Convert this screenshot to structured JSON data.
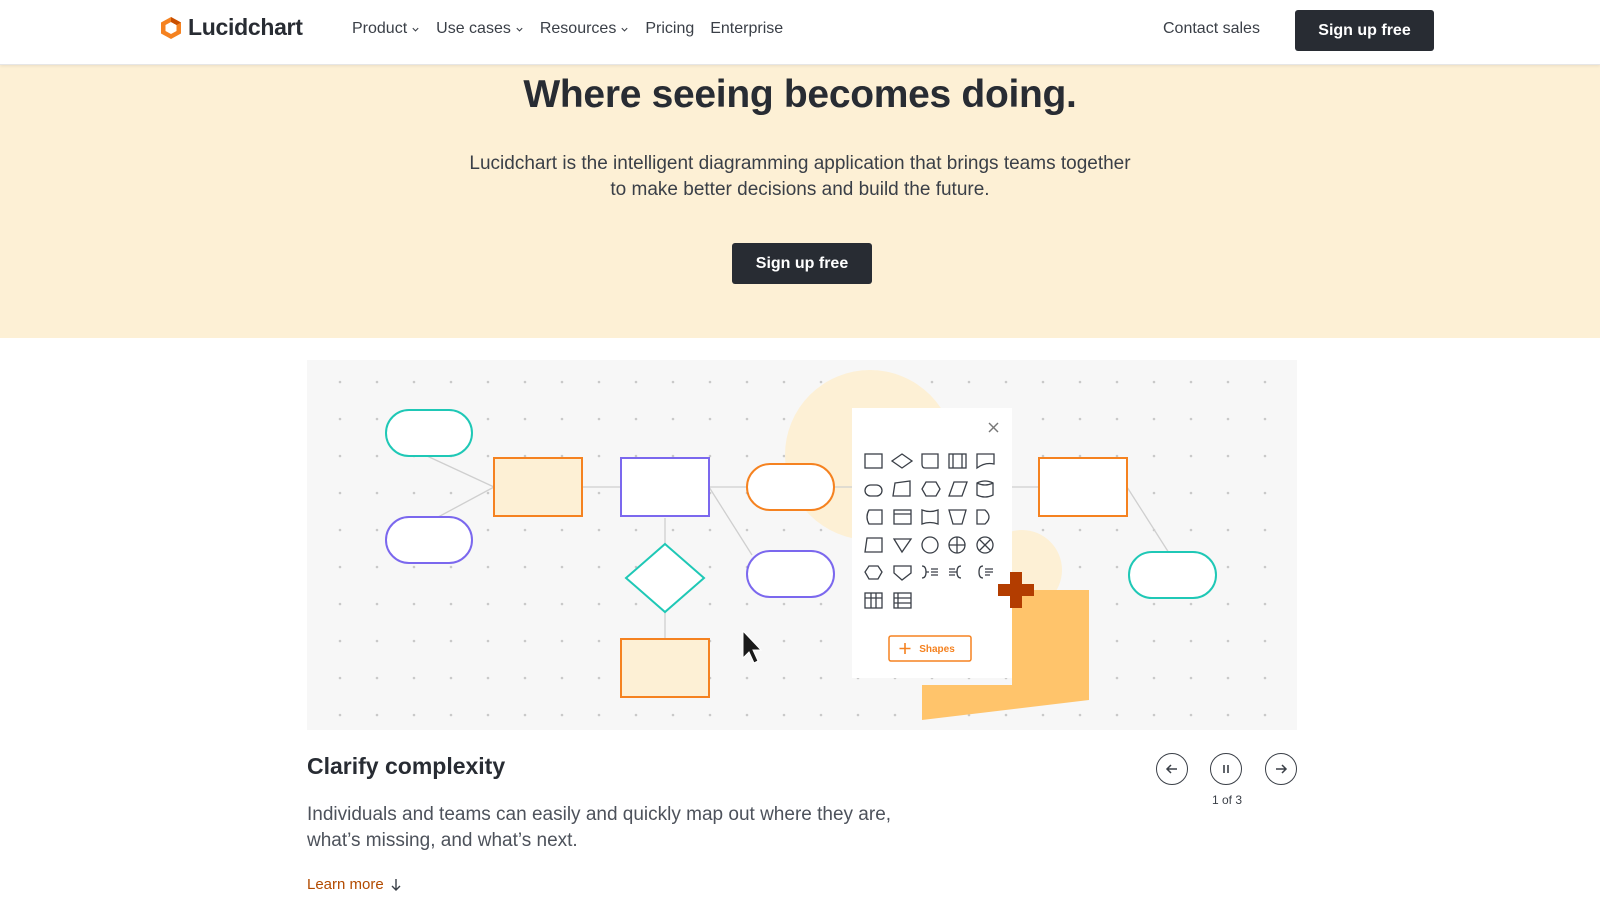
{
  "nav": {
    "logo_text": "Lucidchart",
    "links": [
      {
        "label": "Product",
        "dropdown": true
      },
      {
        "label": "Use cases",
        "dropdown": true
      },
      {
        "label": "Resources",
        "dropdown": true
      },
      {
        "label": "Pricing",
        "dropdown": false
      },
      {
        "label": "Enterprise",
        "dropdown": false
      }
    ],
    "contact_label": "Contact sales",
    "signup_label": "Sign up free"
  },
  "hero": {
    "title": "Where seeing becomes doing.",
    "subtitle_line1": "Lucidchart is the intelligent diagramming application that brings teams together",
    "subtitle_line2": "to make better decisions and build the future.",
    "cta_label": "Sign up free"
  },
  "illustration": {
    "shapes_button_label": "Shapes"
  },
  "carousel": {
    "title": "Clarify complexity",
    "body_line1": "Individuals and teams can easily and quickly map out where they are,",
    "body_line2": "what’s missing, and what’s next.",
    "learn_more": "Learn more",
    "counter": "1 of 3"
  },
  "colors": {
    "hero_bg": "#fdf0d5",
    "dark": "#282c33",
    "orange": "#f58220",
    "teal": "#1fc8b6",
    "purple": "#7b68ee",
    "link_orange": "#b34b00"
  }
}
